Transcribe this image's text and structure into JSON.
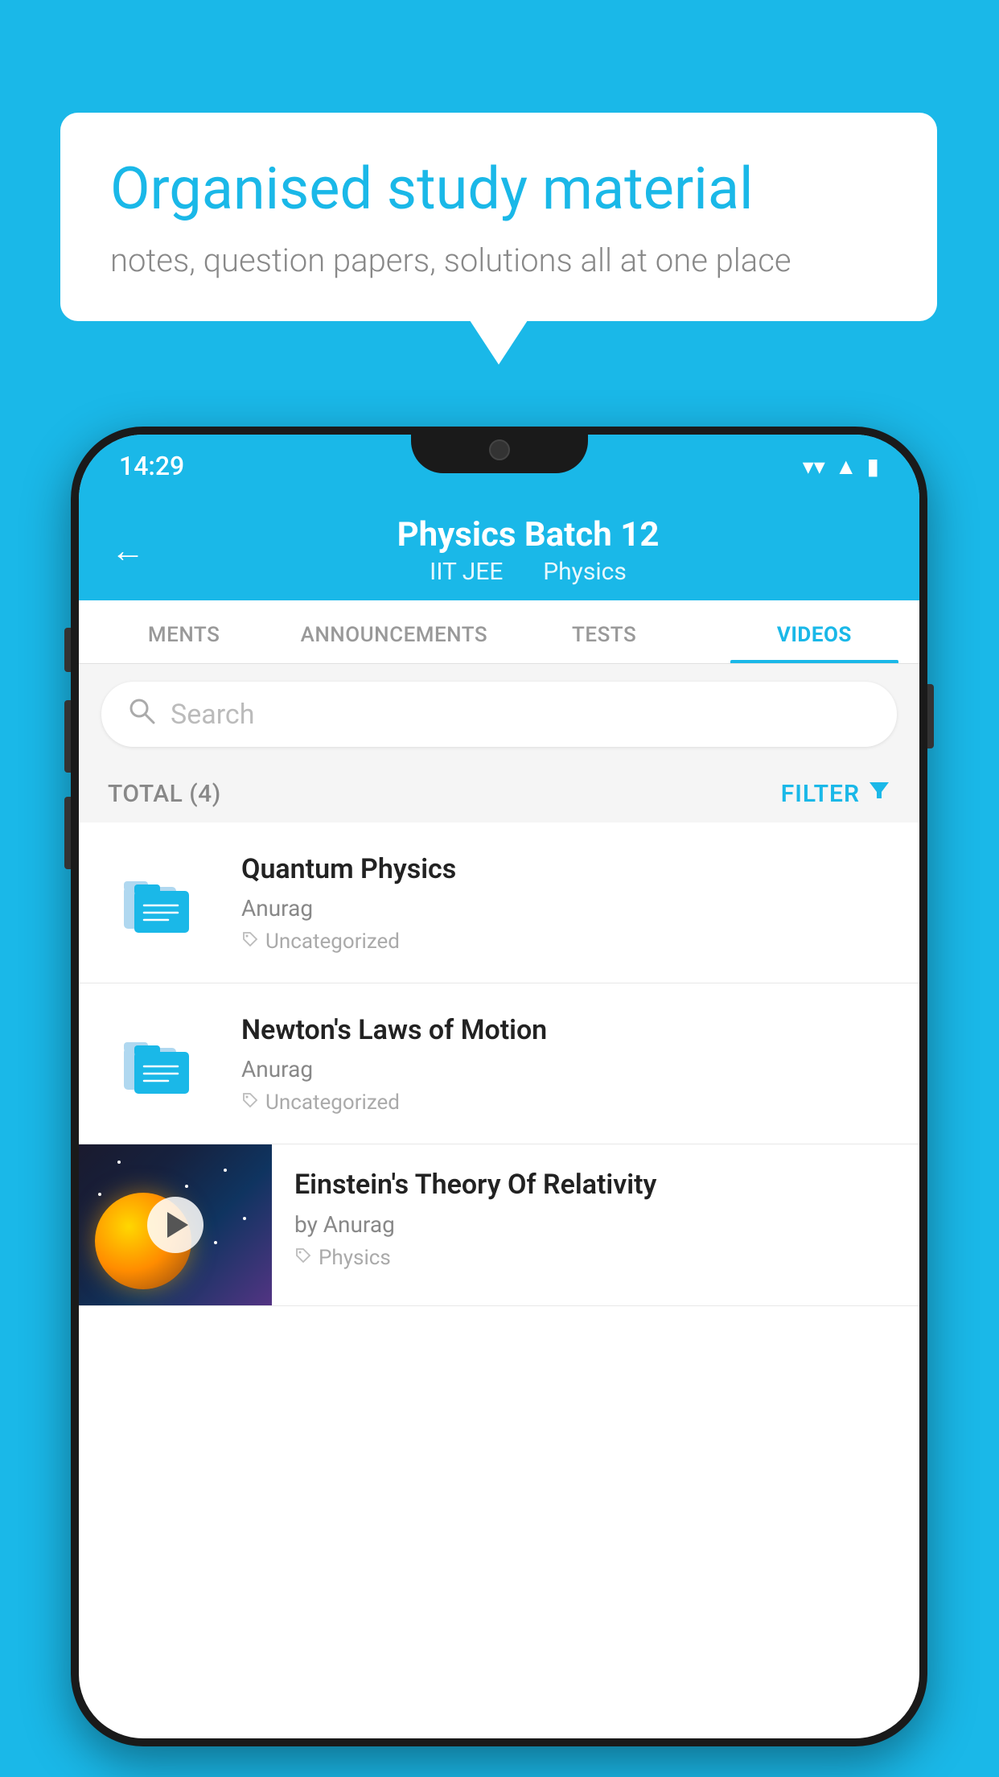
{
  "background_color": "#1ab8e8",
  "speech_bubble": {
    "headline": "Organised study material",
    "subtext": "notes, question papers, solutions all at one place"
  },
  "status_bar": {
    "time": "14:29",
    "wifi": "▼",
    "signal": "▲",
    "battery": "▮"
  },
  "app_header": {
    "back_label": "←",
    "title": "Physics Batch 12",
    "subtitle_part1": "IIT JEE",
    "subtitle_part2": "Physics"
  },
  "tabs": [
    {
      "label": "MENTS",
      "active": false
    },
    {
      "label": "ANNOUNCEMENTS",
      "active": false
    },
    {
      "label": "TESTS",
      "active": false
    },
    {
      "label": "VIDEOS",
      "active": true
    }
  ],
  "search": {
    "placeholder": "Search"
  },
  "filter_bar": {
    "total_label": "TOTAL (4)",
    "filter_label": "FILTER"
  },
  "videos": [
    {
      "title": "Quantum Physics",
      "author": "Anurag",
      "tag": "Uncategorized",
      "has_thumbnail": false
    },
    {
      "title": "Newton's Laws of Motion",
      "author": "Anurag",
      "tag": "Uncategorized",
      "has_thumbnail": false
    },
    {
      "title": "Einstein's Theory Of Relativity",
      "author": "by Anurag",
      "tag": "Physics",
      "has_thumbnail": true
    }
  ]
}
